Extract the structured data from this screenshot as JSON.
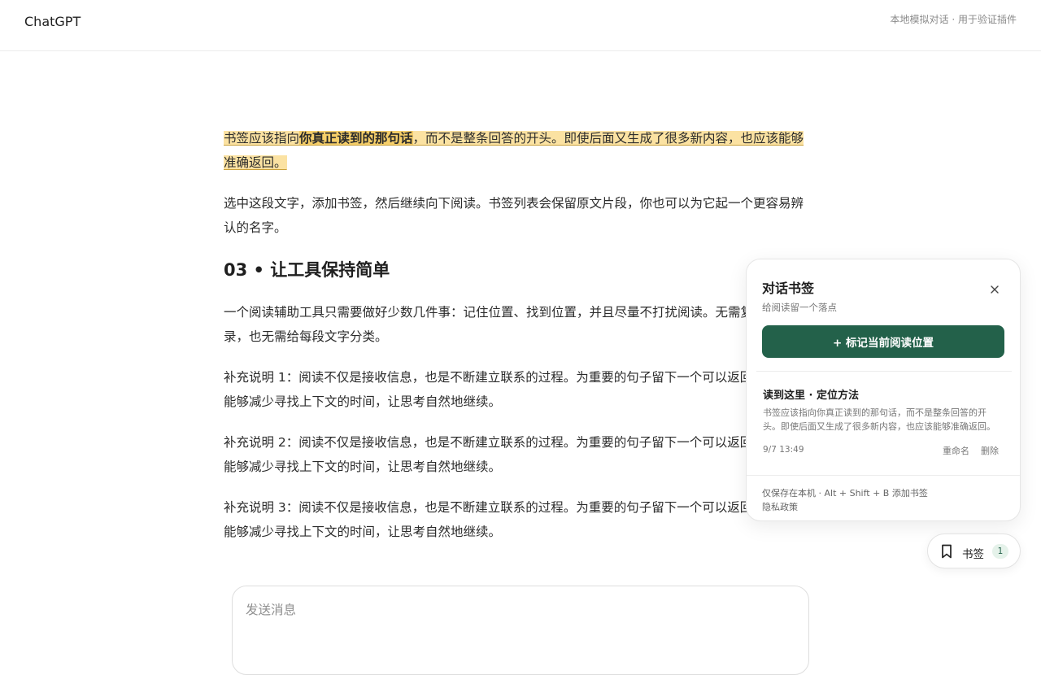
{
  "header": {
    "brand": "ChatGPT",
    "note": "本地模拟对话 · 用于验证插件"
  },
  "article": {
    "p1": {
      "before": "书签应该指向",
      "strong": "你真正读到的那句话",
      "after": "，而不是整条回答的开头。即使后面又生成了很多新内容，也应该能够准确返回。"
    },
    "p2": "选中这段文字，添加书签，然后继续向下阅读。书签列表会保留原文片段，你也可以为它起一个更容易辨认的名字。",
    "heading": "03 • 让工具保持简单",
    "p3": "一个阅读辅助工具只需要做好少数几件事：记住位置、找到位置，并且尽量不打扰阅读。无需复杂的目录，也无需给每段文字分类。",
    "p4": "补充说明 1：阅读不仅是接收信息，也是不断建立联系的过程。为重要的句子留下一个可以返回的位置，能够减少寻找上下文的时间，让思考自然地继续。",
    "p5": "补充说明 2：阅读不仅是接收信息，也是不断建立联系的过程。为重要的句子留下一个可以返回的位置，能够减少寻找上下文的时间，让思考自然地继续。",
    "p6": "补充说明 3：阅读不仅是接收信息，也是不断建立联系的过程。为重要的句子留下一个可以返回的位置，能够减少寻找上下文的时间，让思考自然地继续。"
  },
  "composer": {
    "placeholder": "发送消息"
  },
  "panel": {
    "title": "对话书签",
    "subtitle": "给阅读留一个落点",
    "add_label": "+ 标记当前阅读位置",
    "item": {
      "title": "读到这里 · 定位方法",
      "snippet": "书签应该指向你真正读到的那句话，而不是整条回答的开头。即使后面又生成了很多新内容，也应该能够准确返回。",
      "time": "9/7 13:49",
      "rename": "重命名",
      "delete": "删除"
    },
    "footer": "仅保存在本机 · Alt + Shift + B 添加书签",
    "privacy": "隐私政策"
  },
  "fab": {
    "label": "书签",
    "count": "1"
  },
  "colors": {
    "accent": "#23614a",
    "highlight": "#fbe2a2",
    "highlight_strong": "#f6cf6a"
  }
}
